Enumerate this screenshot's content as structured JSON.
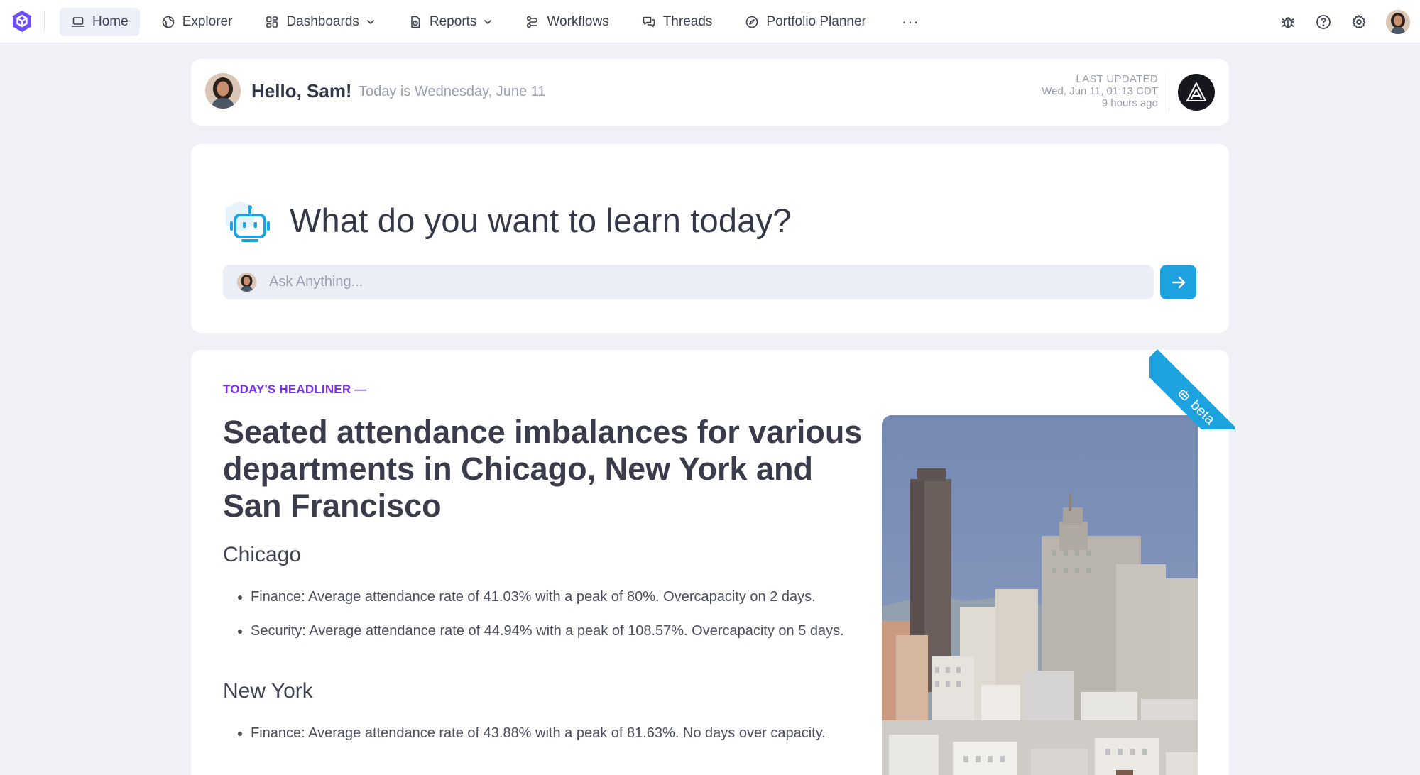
{
  "nav": {
    "items": [
      {
        "label": "Home",
        "icon": "laptop-icon",
        "active": true
      },
      {
        "label": "Explorer",
        "icon": "globe-icon"
      },
      {
        "label": "Dashboards",
        "icon": "grid-icon",
        "dropdown": true
      },
      {
        "label": "Reports",
        "icon": "report-icon",
        "dropdown": true
      },
      {
        "label": "Workflows",
        "icon": "workflow-icon"
      },
      {
        "label": "Threads",
        "icon": "chat-icon"
      },
      {
        "label": "Portfolio Planner",
        "icon": "compass-icon"
      }
    ],
    "more": "···",
    "right_icons": [
      "bug-icon",
      "help-icon",
      "settings-icon"
    ]
  },
  "greeting": {
    "hello": "Hello, Sam!",
    "date": "Today is Wednesday, June 11",
    "updated_label": "LAST UPDATED",
    "updated_time": "Wed, Jun 11, 01:13 CDT",
    "updated_ago": "9 hours ago"
  },
  "ask": {
    "title": "What do you want to learn today?",
    "placeholder": "Ask Anything..."
  },
  "headliner": {
    "kicker": "TODAY'S HEADLINER —",
    "ribbon": "beta",
    "title": "Seated attendance imbalances for various departments in Chicago, New York and San Francisco",
    "sections": [
      {
        "city": "Chicago",
        "bullets": [
          "Finance: Average attendance rate of 41.03% with a peak of 80%. Overcapacity on 2 days.",
          "Security: Average attendance rate of 44.94% with a peak of 108.57%. Overcapacity on 5 days."
        ]
      },
      {
        "city": "New York",
        "bullets": [
          "Finance: Average attendance rate of 43.88% with a peak of 81.63%. No days over capacity."
        ]
      }
    ]
  },
  "colors": {
    "accent": "#1da2e0",
    "kicker": "#7a2ff0",
    "logo": "#6e4df2"
  }
}
